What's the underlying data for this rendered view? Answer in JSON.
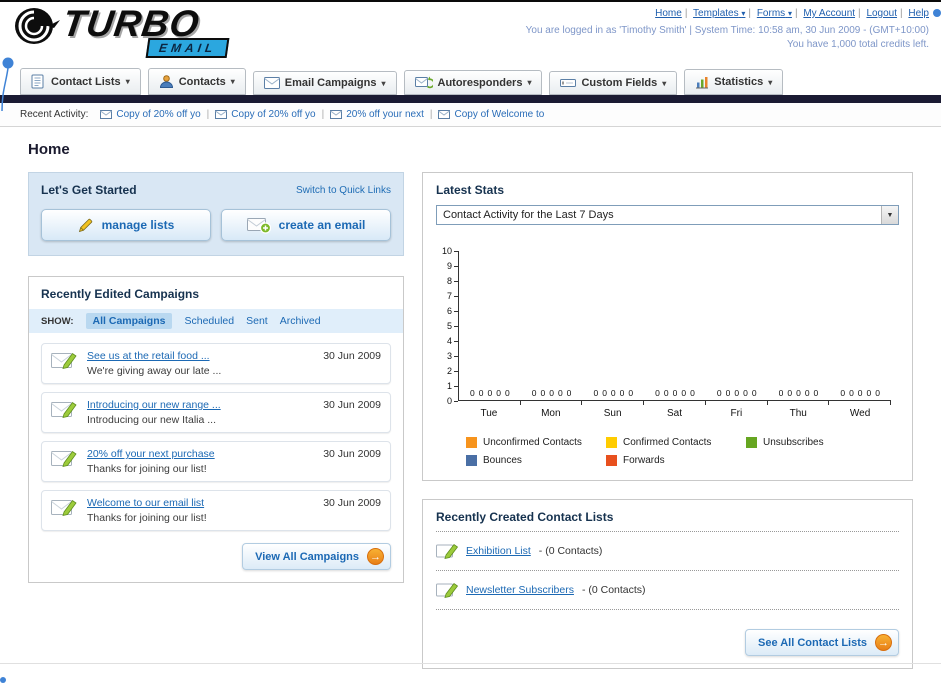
{
  "icons": {
    "chevron_down": "▾",
    "select_caret": "▼",
    "arrow_right": "→",
    "pipe": "|"
  },
  "header": {
    "logo_primary": "TURBO",
    "logo_secondary": "EMAIL",
    "nav": [
      "Home",
      "Templates",
      "Forms",
      "My Account",
      "Logout",
      "Help"
    ],
    "login_info": "You are logged in as 'Timothy Smith' | System Time: 10:58 am, 30 Jun 2009 - (GMT+10:00)",
    "credits": "You have 1,000 total credits left."
  },
  "tabs": [
    "Contact Lists",
    "Contacts",
    "Email Campaigns",
    "Autoresponders",
    "Custom Fields",
    "Statistics"
  ],
  "recent_activity": {
    "label": "Recent Activity:",
    "items": [
      "Copy of 20% off yo",
      "Copy of 20% off yo",
      "20% off your next",
      "Copy of Welcome to"
    ]
  },
  "page": {
    "title": "Home"
  },
  "get_started": {
    "title": "Let's Get Started",
    "switch_link": "Switch to Quick Links",
    "manage_lists": "manage lists",
    "create_email": "create an email"
  },
  "campaigns": {
    "title": "Recently Edited Campaigns",
    "show_label": "SHOW:",
    "filters": [
      "All Campaigns",
      "Scheduled",
      "Sent",
      "Archived"
    ],
    "items": [
      {
        "title": "See us at the retail food ...",
        "subtitle": "We're giving away our late ...",
        "date": "30 Jun 2009"
      },
      {
        "title": "Introducing our new range ...",
        "subtitle": "Introducing our new Italia ...",
        "date": "30 Jun 2009"
      },
      {
        "title": "20% off your next purchase",
        "subtitle": "Thanks for joining our list!",
        "date": "30 Jun 2009"
      },
      {
        "title": "Welcome to our email list",
        "subtitle": "Thanks for joining our list!",
        "date": "30 Jun 2009"
      }
    ],
    "view_all_label": "View All Campaigns"
  },
  "stats": {
    "title": "Latest Stats",
    "period_selected": "Contact Activity for the Last 7 Days"
  },
  "chart_data": {
    "type": "bar",
    "title": "Contact Activity for the Last 7 Days",
    "categories": [
      "Tue",
      "Mon",
      "Sun",
      "Sat",
      "Fri",
      "Thu",
      "Wed"
    ],
    "series": [
      {
        "name": "Unconfirmed Contacts",
        "color": "#F7941D",
        "values": [
          0,
          0,
          0,
          0,
          0,
          0,
          0
        ]
      },
      {
        "name": "Confirmed Contacts",
        "color": "#FFCC00",
        "values": [
          0,
          0,
          0,
          0,
          0,
          0,
          0
        ]
      },
      {
        "name": "Unsubscribes",
        "color": "#66A621",
        "values": [
          0,
          0,
          0,
          0,
          0,
          0,
          0
        ]
      },
      {
        "name": "Bounces",
        "color": "#4A6FA5",
        "values": [
          0,
          0,
          0,
          0,
          0,
          0,
          0
        ]
      },
      {
        "name": "Forwards",
        "color": "#E8501E",
        "values": [
          0,
          0,
          0,
          0,
          0,
          0,
          0
        ]
      }
    ],
    "ylim": [
      0,
      10
    ],
    "y_step": 1,
    "grid": false,
    "legend_position": "bottom"
  },
  "contact_lists": {
    "title": "Recently Created Contact Lists",
    "items": [
      {
        "name": "Exhibition List",
        "detail": "- (0 Contacts)"
      },
      {
        "name": "Newsletter Subscribers",
        "detail": "- (0 Contacts)"
      }
    ],
    "see_all_label": "See All Contact Lists"
  }
}
